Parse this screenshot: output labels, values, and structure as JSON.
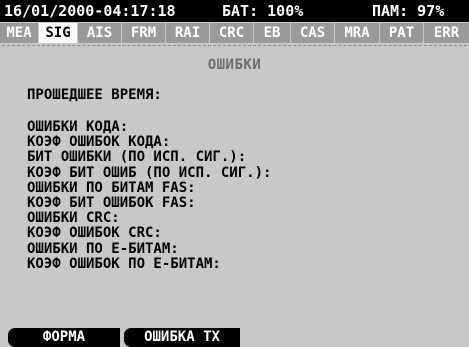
{
  "status_bar": {
    "datetime": "16/01/2000-04:17:18",
    "battery": "БАТ: 100%",
    "memory": "ПАМ: 97%"
  },
  "tabs": [
    {
      "label": "MEA",
      "active": false
    },
    {
      "label": "SIG",
      "active": true
    },
    {
      "label": "AIS",
      "active": false
    },
    {
      "label": "FRM",
      "active": false
    },
    {
      "label": "RAI",
      "active": false
    },
    {
      "label": "CRC",
      "active": false
    },
    {
      "label": "EB",
      "active": false
    },
    {
      "label": "CAS",
      "active": false
    },
    {
      "label": "MRA",
      "active": false
    },
    {
      "label": "PAT",
      "active": false
    },
    {
      "label": "ERR",
      "active": false
    }
  ],
  "panel": {
    "title": "ОШИБКИ",
    "elapsed_label": "ПРОШЕДШЕЕ ВРЕМЯ:",
    "fields": [
      "ОШИБКИ КОДА:",
      "КОЭФ ОШИБОК КОДА:",
      "БИТ ОШИБКИ (ПО ИСП. СИГ.):",
      "КОЭФ БИТ ОШИБ (ПО ИСП. СИГ.):",
      "ОШИБКИ ПО БИТАМ FAS:",
      "КОЭФ БИТ ОШИБОК FAS:",
      "ОШИБКИ CRC:",
      "КОЭФ ОШИБОК CRC:",
      "ОШИБКИ ПО Е-БИТАМ:",
      "КОЭФ ОШИБОК ПО Е-БИТАМ:"
    ]
  },
  "softkeys": {
    "key1": "ФОРМА",
    "key2": "ОШИБКА ТХ"
  }
}
